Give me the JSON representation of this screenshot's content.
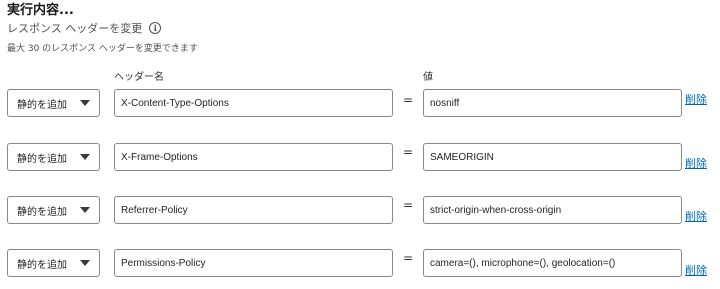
{
  "section": {
    "title": "実行内容...",
    "action_label": "レスポンス ヘッダーを変更",
    "info_icon": "ⓘ",
    "hint": "最大 30 のレスポンス ヘッダーを変更できます"
  },
  "columns": {
    "name_header": "ヘッダー名",
    "value_header": "値"
  },
  "rows": [
    {
      "operation": "静的を追加",
      "name": "X-Content-Type-Options",
      "equals": "=",
      "value": "nosniff",
      "delete": "削除"
    },
    {
      "operation": "静的を追加",
      "name": "X-Frame-Options",
      "equals": "=",
      "value": "SAMEORIGIN",
      "delete": "削除"
    },
    {
      "operation": "静的を追加",
      "name": "Referrer-Policy",
      "equals": "=",
      "value": "strict-origin-when-cross-origin",
      "delete": "削除"
    },
    {
      "operation": "静的を追加",
      "name": "Permissions-Policy",
      "equals": "=",
      "value": "camera=(), microphone=(), geolocation=()",
      "delete": "削除"
    }
  ]
}
